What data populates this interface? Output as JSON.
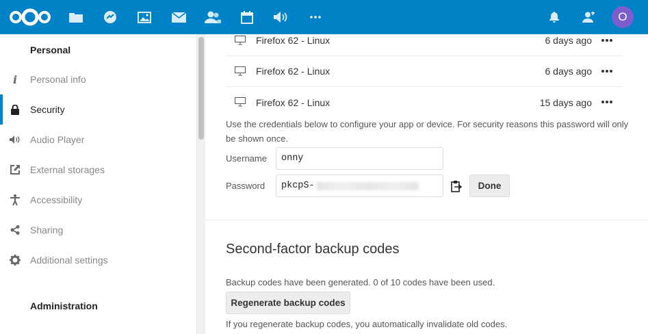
{
  "header": {
    "apps": [
      {
        "name": "files-icon"
      },
      {
        "name": "activity-icon"
      },
      {
        "name": "photos-icon"
      },
      {
        "name": "mail-icon"
      },
      {
        "name": "contacts-icon"
      },
      {
        "name": "calendar-icon"
      },
      {
        "name": "audio-player-icon"
      },
      {
        "name": "more-apps-icon"
      }
    ],
    "avatar_letter": "O",
    "brand_color": "#0082c9",
    "avatar_color": "#7b5ecc"
  },
  "sidebar": {
    "personal_caption": "Personal",
    "items": [
      {
        "label": "Personal info",
        "icon": "info-icon"
      },
      {
        "label": "Security",
        "icon": "lock-icon",
        "active": true
      },
      {
        "label": "Audio Player",
        "icon": "speaker-icon"
      },
      {
        "label": "External storages",
        "icon": "external-link-icon"
      },
      {
        "label": "Accessibility",
        "icon": "accessibility-icon"
      },
      {
        "label": "Sharing",
        "icon": "share-icon"
      },
      {
        "label": "Additional settings",
        "icon": "gear-icon"
      }
    ],
    "admin_caption": "Administration"
  },
  "sessions": [
    {
      "device": "Firefox 62 - Linux",
      "last_active": "6 days ago"
    },
    {
      "device": "Firefox 62 - Linux",
      "last_active": "6 days ago"
    },
    {
      "device": "Firefox 62 - Linux",
      "last_active": "15 days ago"
    }
  ],
  "app_password": {
    "info": "Use the credentials below to configure your app or device. For security reasons this password will only be shown once.",
    "username_label": "Username",
    "username_value": "onny",
    "password_label": "Password",
    "password_visible_prefix": "pkcpS-",
    "done_label": "Done"
  },
  "backup_codes": {
    "title": "Second-factor backup codes",
    "status": "Backup codes have been generated. 0 of 10 codes have been used.",
    "regenerate_label": "Regenerate backup codes",
    "hint": "If you regenerate backup codes, you automatically invalidate old codes."
  }
}
